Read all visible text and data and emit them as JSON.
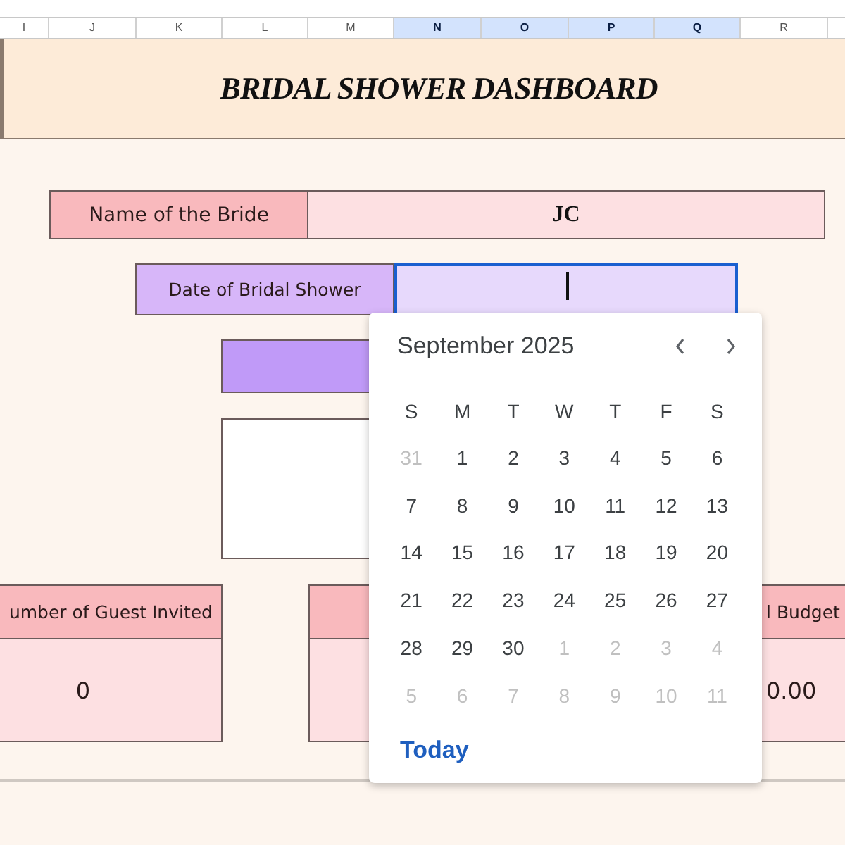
{
  "columns": [
    {
      "label": "I",
      "selected": false
    },
    {
      "label": "J",
      "selected": false
    },
    {
      "label": "K",
      "selected": false
    },
    {
      "label": "L",
      "selected": false
    },
    {
      "label": "M",
      "selected": false
    },
    {
      "label": "N",
      "selected": true
    },
    {
      "label": "O",
      "selected": true
    },
    {
      "label": "P",
      "selected": true
    },
    {
      "label": "Q",
      "selected": true
    },
    {
      "label": "R",
      "selected": false
    }
  ],
  "title": "BRIDAL SHOWER DASHBOARD",
  "bride": {
    "label": "Name of the Bride",
    "value": "JC"
  },
  "date": {
    "label": "Date of Bridal Shower",
    "focused": true
  },
  "cards": [
    {
      "kind": "stat",
      "label": "umber of Guest Invited",
      "value": "0"
    },
    {
      "kind": "blank"
    },
    {
      "kind": "stat",
      "label": "l Budget",
      "value": "0.00"
    }
  ],
  "calendar": {
    "month": "September 2025",
    "weekdays": [
      "S",
      "M",
      "T",
      "W",
      "T",
      "F",
      "S"
    ],
    "weeks": [
      [
        {
          "day": "31",
          "muted": true
        },
        {
          "day": "1",
          "muted": false
        },
        {
          "day": "2",
          "muted": false
        },
        {
          "day": "3",
          "muted": false
        },
        {
          "day": "4",
          "muted": false
        },
        {
          "day": "5",
          "muted": false
        },
        {
          "day": "6",
          "muted": false
        }
      ],
      [
        {
          "day": "7",
          "muted": false
        },
        {
          "day": "8",
          "muted": false
        },
        {
          "day": "9",
          "muted": false
        },
        {
          "day": "10",
          "muted": false
        },
        {
          "day": "11",
          "muted": false
        },
        {
          "day": "12",
          "muted": false
        },
        {
          "day": "13",
          "muted": false
        }
      ],
      [
        {
          "day": "14",
          "muted": false
        },
        {
          "day": "15",
          "muted": false
        },
        {
          "day": "16",
          "muted": false
        },
        {
          "day": "17",
          "muted": false
        },
        {
          "day": "18",
          "muted": false
        },
        {
          "day": "19",
          "muted": false
        },
        {
          "day": "20",
          "muted": false
        }
      ],
      [
        {
          "day": "21",
          "muted": false
        },
        {
          "day": "22",
          "muted": false
        },
        {
          "day": "23",
          "muted": false
        },
        {
          "day": "24",
          "muted": false
        },
        {
          "day": "25",
          "muted": false
        },
        {
          "day": "26",
          "muted": false
        },
        {
          "day": "27",
          "muted": false
        }
      ],
      [
        {
          "day": "28",
          "muted": false
        },
        {
          "day": "29",
          "muted": false
        },
        {
          "day": "30",
          "muted": false
        },
        {
          "day": "1",
          "muted": true
        },
        {
          "day": "2",
          "muted": true
        },
        {
          "day": "3",
          "muted": true
        },
        {
          "day": "4",
          "muted": true
        }
      ],
      [
        {
          "day": "5",
          "muted": true
        },
        {
          "day": "6",
          "muted": true
        },
        {
          "day": "7",
          "muted": true
        },
        {
          "day": "8",
          "muted": true
        },
        {
          "day": "9",
          "muted": true
        },
        {
          "day": "10",
          "muted": true
        },
        {
          "day": "11",
          "muted": true
        }
      ]
    ],
    "today": "Today"
  }
}
